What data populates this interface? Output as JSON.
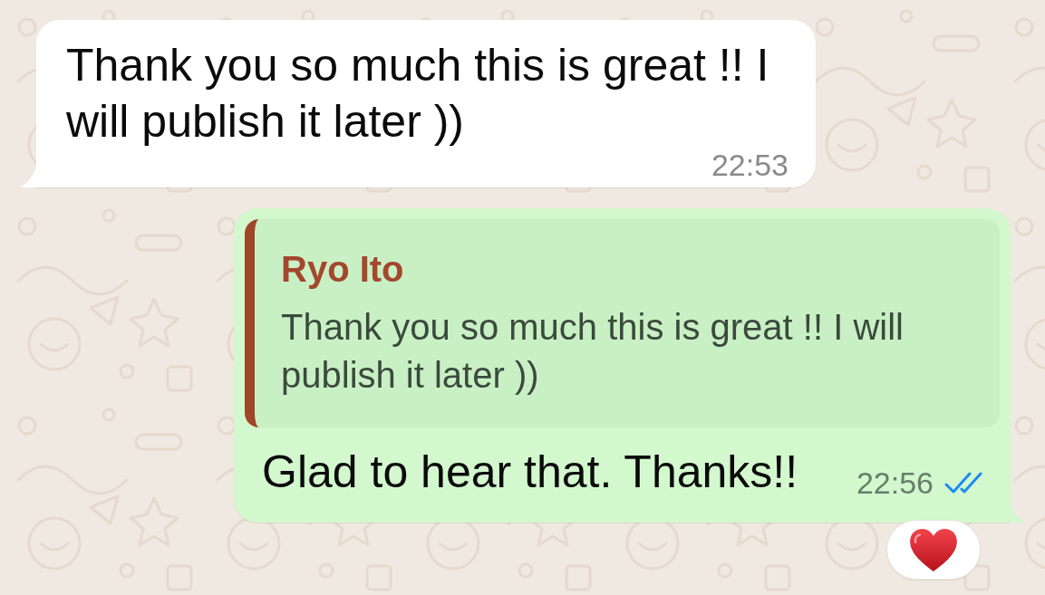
{
  "messages": [
    {
      "kind": "incoming",
      "text": "Thank you so much this is great !! I will publish it later ))",
      "time": "22:53"
    },
    {
      "kind": "outgoing",
      "quote": {
        "author": "Ryo Ito",
        "text": "Thank you so much this is great !! I will publish it later ))"
      },
      "text": "Glad to hear that. Thanks!!",
      "time": "22:56",
      "read": true,
      "reactions": [
        {
          "kind": "heart"
        }
      ]
    }
  ]
}
